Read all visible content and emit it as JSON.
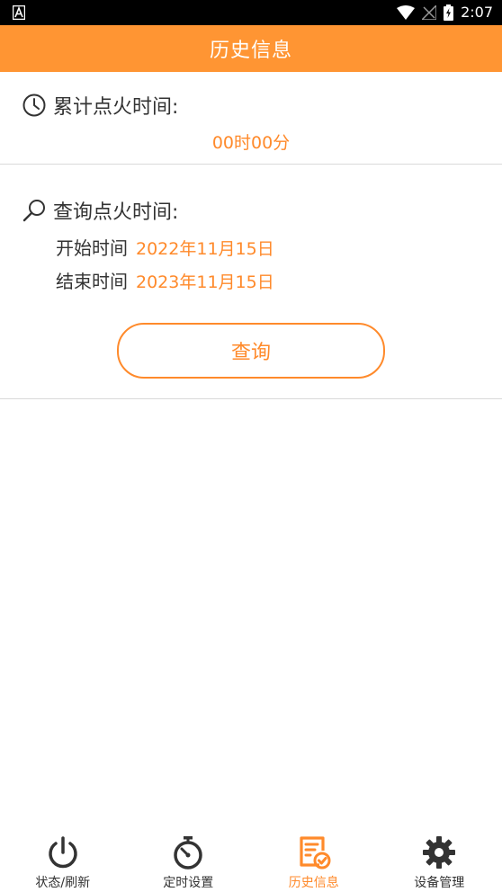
{
  "status_bar": {
    "time": "2:07",
    "icons": [
      "app-a-icon",
      "wifi-icon",
      "signal-off-icon",
      "battery-charging-icon"
    ]
  },
  "header": {
    "title": "历史信息"
  },
  "total": {
    "label": "累计点火时间:",
    "value": "00时00分",
    "icon": "clock-icon"
  },
  "query": {
    "label": "查询点火时间:",
    "icon": "search-icon",
    "start_label": "开始时间",
    "start_value": "2022年11月15日",
    "end_label": "结束时间",
    "end_value": "2023年11月15日",
    "button_label": "查询"
  },
  "tabs": [
    {
      "label": "状态/刷新",
      "icon": "power-icon",
      "active": false
    },
    {
      "label": "定时设置",
      "icon": "stopwatch-icon",
      "active": false
    },
    {
      "label": "历史信息",
      "icon": "history-document-icon",
      "active": true
    },
    {
      "label": "设备管理",
      "icon": "gear-icon",
      "active": false
    }
  ],
  "colors": {
    "accent": "#ff9533",
    "accent_text": "#ff8a2b",
    "text": "#333333",
    "divider": "#d9d9d9"
  }
}
